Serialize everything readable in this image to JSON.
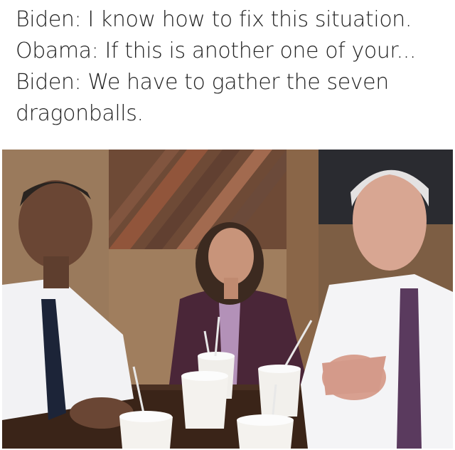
{
  "caption": {
    "lines": [
      "Biden: I know how to fix this situation.",
      "Obama: If this is another one of your...",
      "Biden: We have to gather the seven",
      "dragonballs."
    ]
  },
  "photo": {
    "subject": "three-people-at-restaurant-table-with-milkshake-cups"
  }
}
